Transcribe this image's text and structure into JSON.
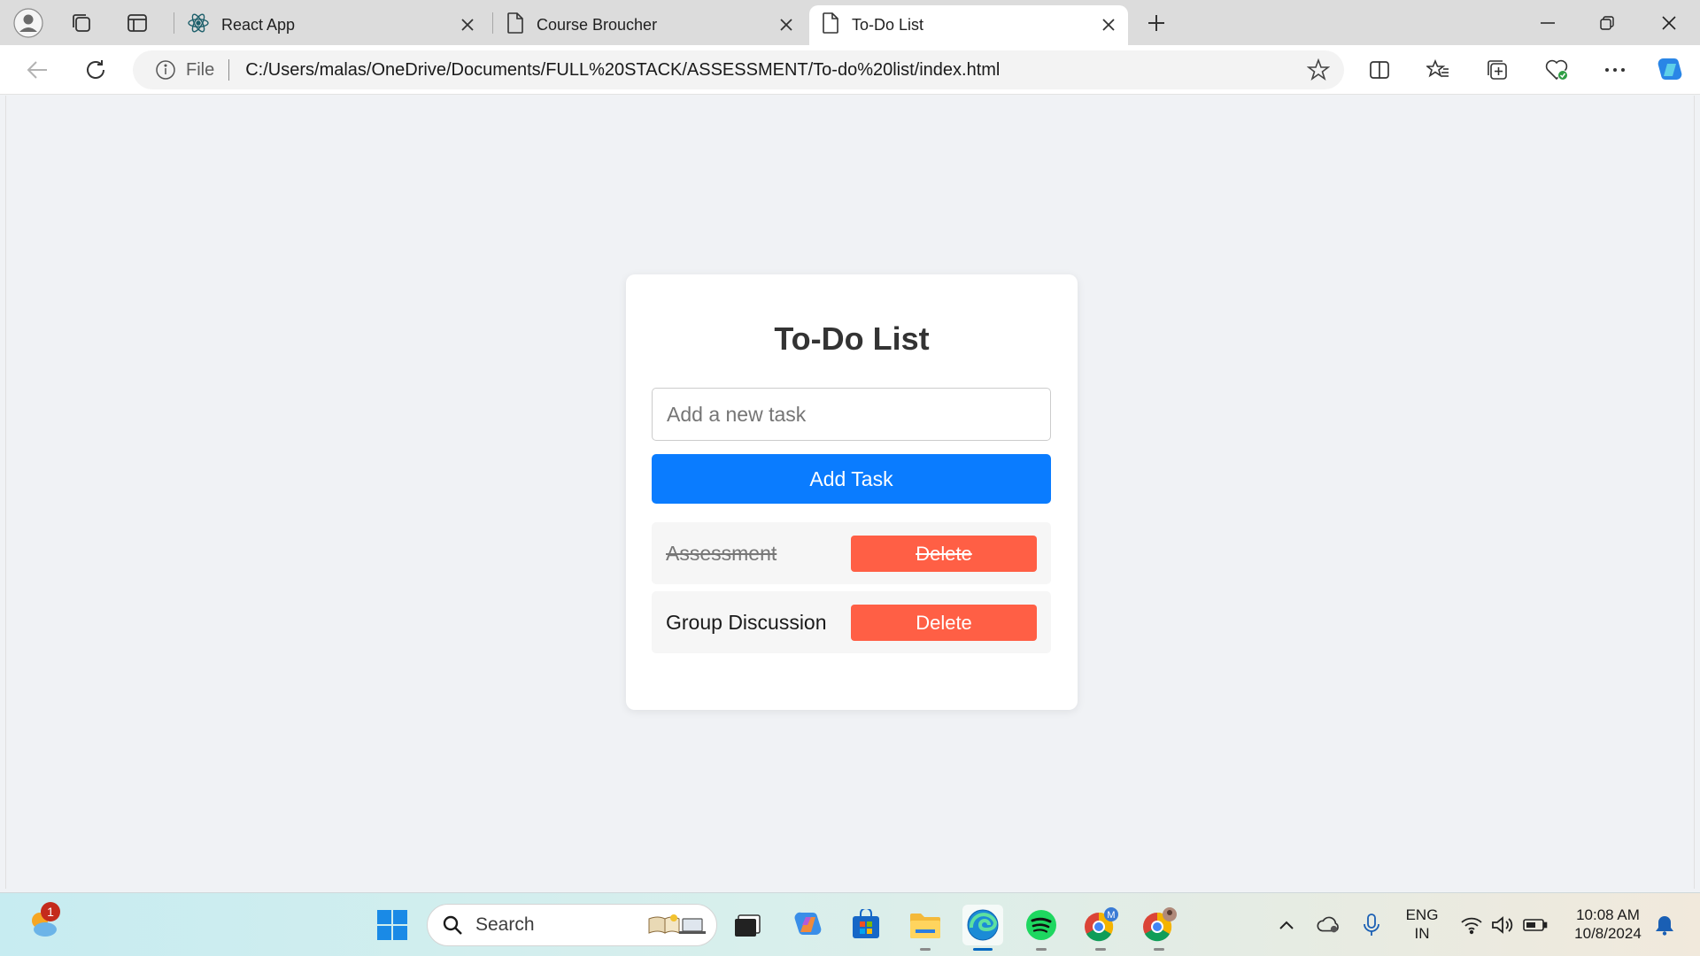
{
  "browser": {
    "tabs": [
      {
        "title": "React App",
        "icon": "react-icon",
        "active": false
      },
      {
        "title": "Course Broucher",
        "icon": "page-icon",
        "active": false
      },
      {
        "title": "To-Do List",
        "icon": "page-icon",
        "active": true
      }
    ],
    "address": {
      "protocol_label": "File",
      "url": "C:/Users/malas/OneDrive/Documents/FULL%20STACK/ASSESSMENT/To-do%20list/index.html"
    }
  },
  "page": {
    "title": "To-Do List",
    "input": {
      "placeholder": "Add a new task",
      "value": ""
    },
    "add_button_label": "Add Task",
    "tasks": [
      {
        "text": "Assessment",
        "completed": true,
        "delete_label": "Delete"
      },
      {
        "text": "Group Discussion",
        "completed": false,
        "delete_label": "Delete"
      }
    ],
    "colors": {
      "primary": "#0a7cff",
      "danger": "#ff5f45",
      "background": "#f0f2f5"
    }
  },
  "taskbar": {
    "search_placeholder": "Search",
    "weather_badge": "1",
    "language": {
      "line1": "ENG",
      "line2": "IN"
    },
    "clock": {
      "time": "10:08 AM",
      "date": "10/8/2024"
    }
  }
}
